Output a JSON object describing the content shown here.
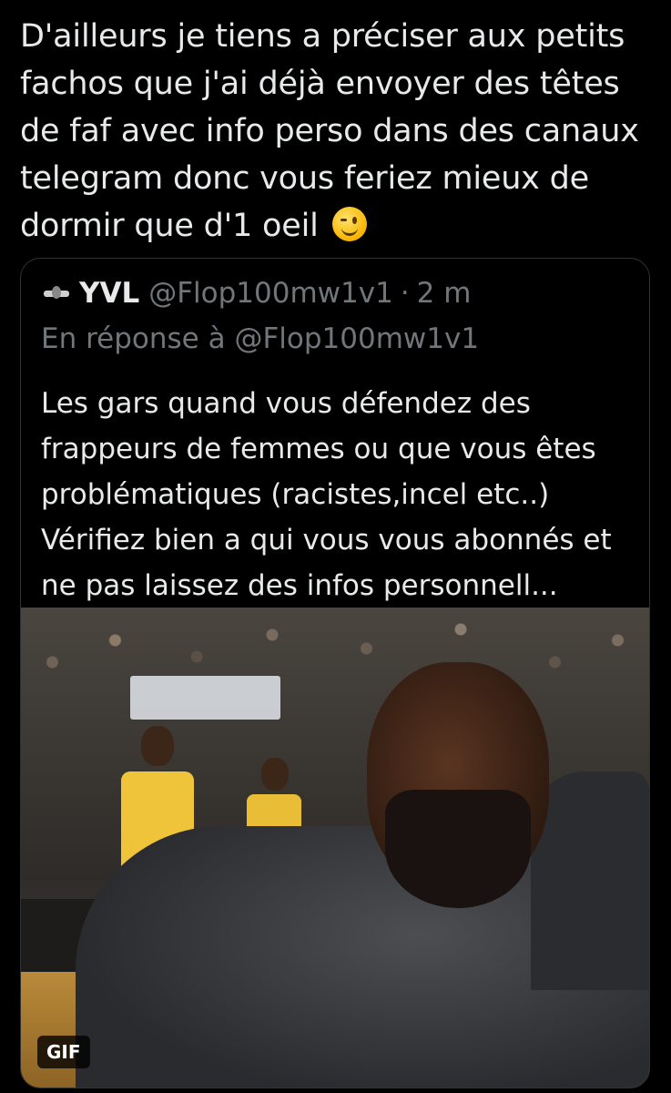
{
  "tweet": {
    "text": "D'ailleurs je tiens a préciser aux petits fachos que j'ai déjà envoyer des têtes de faf avec info perso dans des canaux telegram donc vous feriez mieux de dormir que d'1 oeil",
    "emoji": "winking-face"
  },
  "quoted": {
    "name": "YVL",
    "handle": "@Flop100mw1v1",
    "dot": "·",
    "time": "2 m",
    "reply_to": "En réponse à @Flop100mw1v1",
    "text": "Les gars quand vous défendez des frappeurs de femmes ou que vous êtes problématiques (racistes,incel etc..) Vérifiez bien a qui vous vous abonnés et ne pas laissez des infos personnell...",
    "media": {
      "badge": "GIF"
    }
  }
}
